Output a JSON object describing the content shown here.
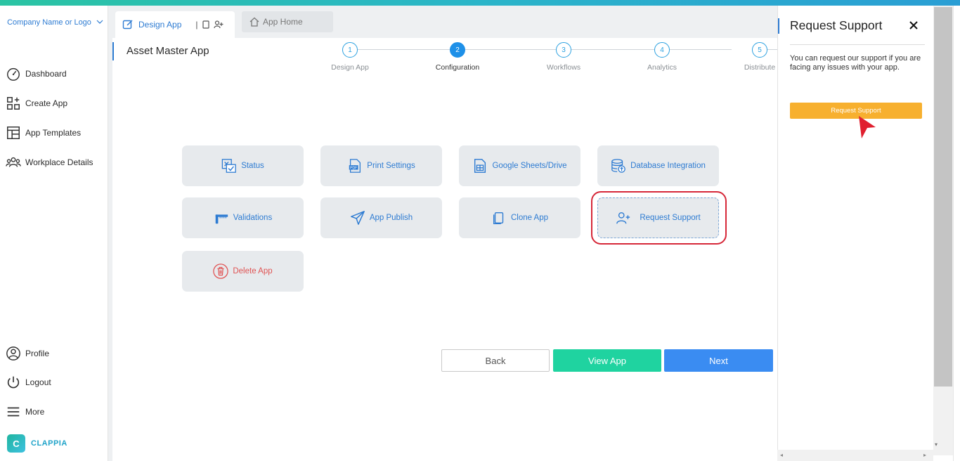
{
  "company": {
    "name": "Company Name or Logo"
  },
  "sidebar": {
    "items": [
      {
        "label": "Dashboard",
        "icon": "dashboard-gauge-icon"
      },
      {
        "label": "Create App",
        "icon": "create-app-grid-icon"
      },
      {
        "label": "App Templates",
        "icon": "templates-layout-icon"
      },
      {
        "label": "Workplace Details",
        "icon": "people-group-icon"
      }
    ],
    "bottom_items": [
      {
        "label": "Profile",
        "icon": "user-circle-icon"
      },
      {
        "label": "Logout",
        "icon": "power-icon"
      },
      {
        "label": "More",
        "icon": "hamburger-menu-icon"
      }
    ],
    "brand": "CLAPPIA"
  },
  "tabs": {
    "active": "Design App",
    "separator": "|",
    "home": "App Home"
  },
  "page": {
    "title": "Asset Master App"
  },
  "stepper": {
    "steps": [
      {
        "num": "1",
        "label": "Design App",
        "active": false
      },
      {
        "num": "2",
        "label": "Configuration",
        "active": true
      },
      {
        "num": "3",
        "label": "Workflows",
        "active": false
      },
      {
        "num": "4",
        "label": "Analytics",
        "active": false
      },
      {
        "num": "5",
        "label": "Distribute",
        "active": false
      }
    ]
  },
  "cards": [
    {
      "label": "Status",
      "icon": "status-checklist-icon"
    },
    {
      "label": "Print Settings",
      "icon": "pdf-file-icon"
    },
    {
      "label": "Google Sheets/Drive",
      "icon": "spreadsheet-icon"
    },
    {
      "label": "Database Integration",
      "icon": "database-icon"
    },
    {
      "label": "Validations",
      "icon": "validation-ruler-icon"
    },
    {
      "label": "App Publish",
      "icon": "paper-plane-icon"
    },
    {
      "label": "Clone App",
      "icon": "copy-icon"
    },
    {
      "label": "Request Support",
      "icon": "add-user-icon"
    },
    {
      "label": "Delete App",
      "icon": "trash-icon"
    }
  ],
  "actions": {
    "back": "Back",
    "view": "View App",
    "next": "Next"
  },
  "support_panel": {
    "title": "Request Support",
    "description": "You can request our support if you are facing any issues with your app.",
    "button": "Request Support"
  },
  "colors": {
    "accent_blue": "#2d7bd2",
    "step_active": "#1e90e8",
    "view_green": "#1fd3a0",
    "next_blue": "#3a8cf2",
    "support_orange": "#f7b02f",
    "danger_red": "#e05353",
    "highlight_red": "#d62839"
  }
}
